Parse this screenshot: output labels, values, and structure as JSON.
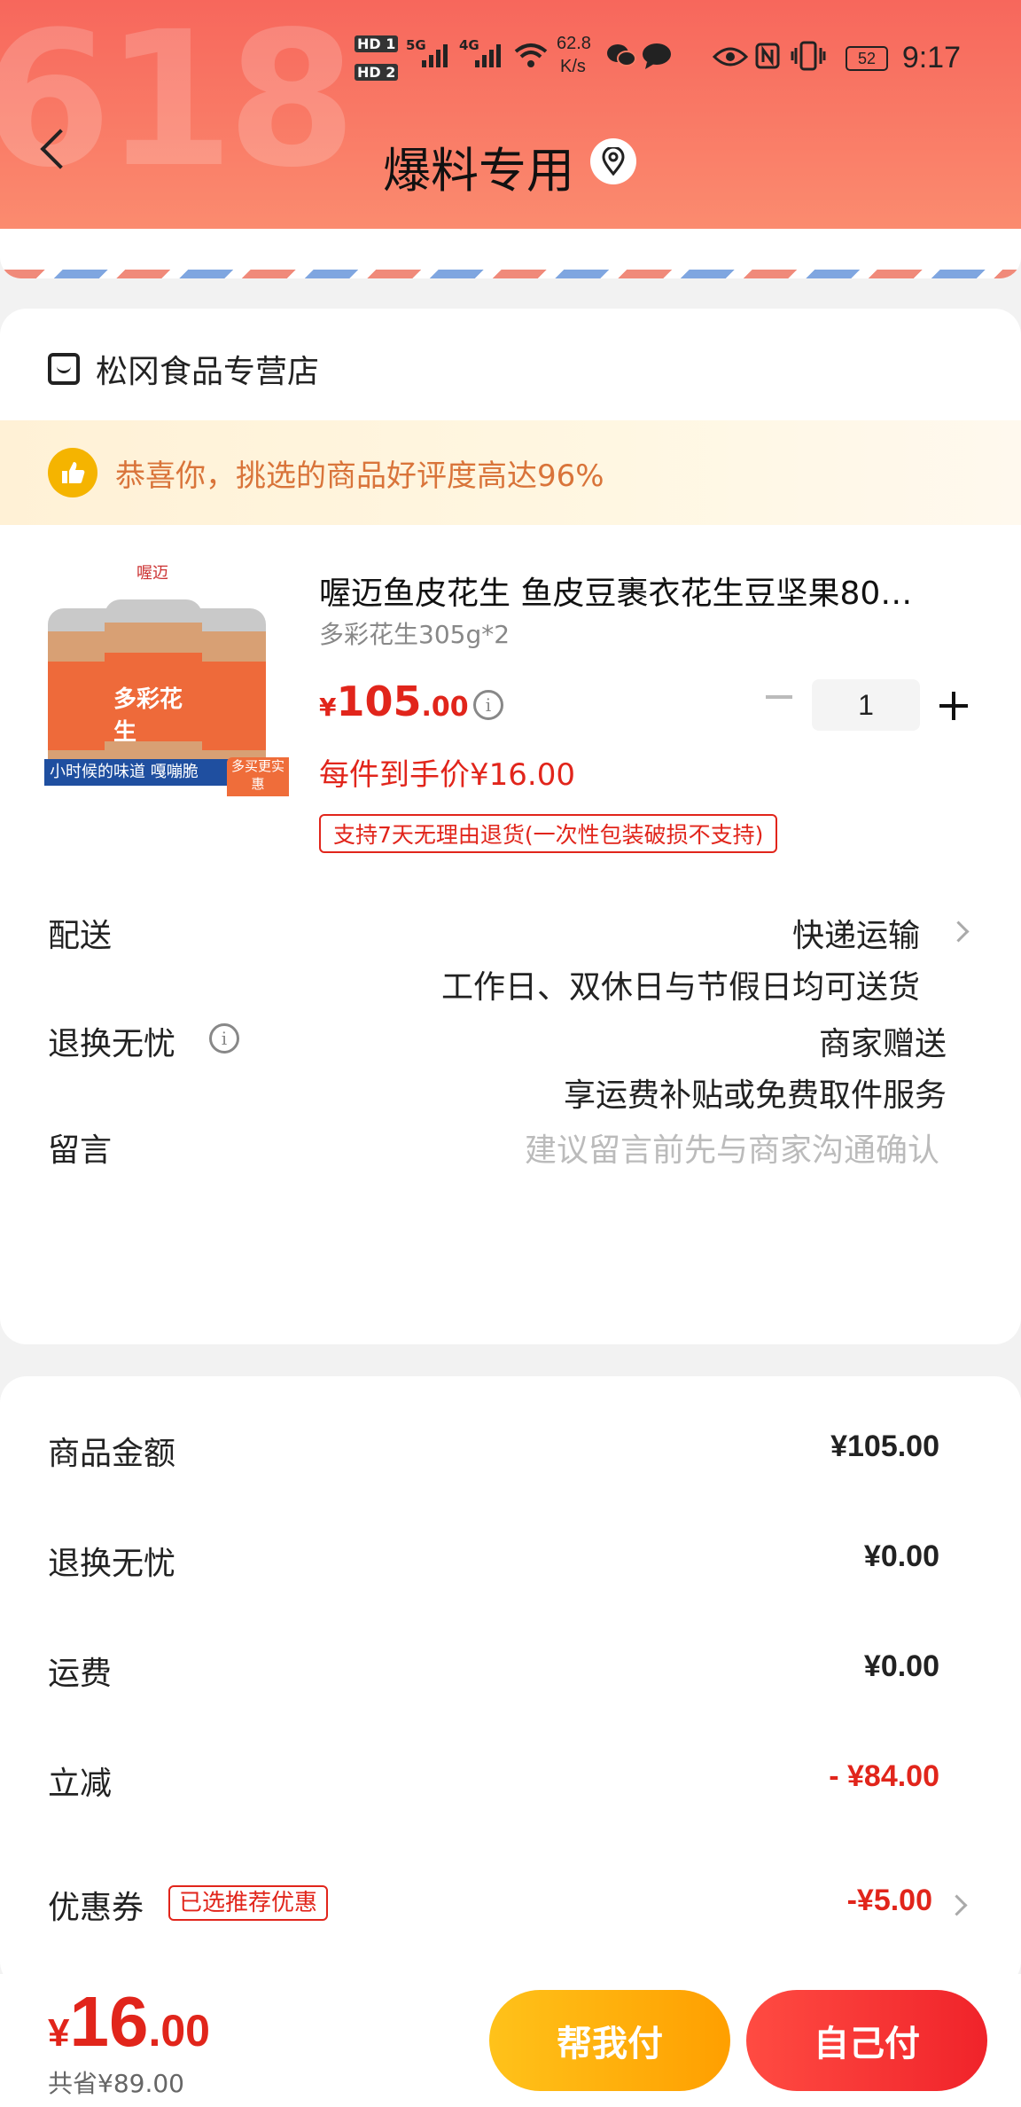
{
  "status_bar": {
    "hd1": "HD 1",
    "hd2": "HD 2",
    "net1": "5G",
    "net2": "4G",
    "speed": "62.8",
    "speed_unit": "K/s",
    "battery": "52",
    "time": "9:17"
  },
  "header": {
    "bg_text": "618",
    "title": "爆料专用"
  },
  "shop": {
    "name": "松冈食品专营店"
  },
  "praise": {
    "text": "恭喜你，挑选的商品好评度高达96%"
  },
  "product": {
    "image_brand": "喔迈",
    "image_label": "多彩花生",
    "image_banner": "小时候的味道 嘎嘣脆",
    "image_tag": "多买更实惠",
    "name": "喔迈鱼皮花生 鱼皮豆裹衣花生豆坚果80…",
    "spec": "多彩花生305g*2",
    "price_currency": "¥",
    "price_int": "105",
    "price_dec": ".00",
    "quantity": "1",
    "unit_price": "每件到手价¥16.00",
    "return_tag": "支持7天无理由退货(一次性包装破损不支持)"
  },
  "delivery": {
    "label": "配送",
    "method": "快递运输",
    "note": "工作日、双休日与节假日均可送货"
  },
  "worry_free": {
    "label": "退换无忧",
    "value": "商家赠送",
    "note": "享运费补贴或免费取件服务"
  },
  "message": {
    "label": "留言",
    "placeholder": "建议留言前先与商家沟通确认"
  },
  "summary": {
    "rows": [
      {
        "label": "商品金额",
        "value": "¥105.00"
      },
      {
        "label": "退换无忧",
        "value": "¥0.00"
      },
      {
        "label": "运费",
        "value": "¥0.00"
      },
      {
        "label": "立减",
        "value": "- ¥84.00"
      },
      {
        "label": "优惠券",
        "value": "-¥5.00"
      }
    ],
    "coupon_tag": "已选推荐优惠"
  },
  "bottom": {
    "currency": "¥",
    "total_int": "16",
    "total_dec": ".00",
    "saved": "共省¥89.00",
    "help_pay": "帮我付",
    "self_pay": "自己付"
  },
  "colors": {
    "accent_red": "#e1251b",
    "header_gradient_start": "#f7675c",
    "help_button": "#ffb000",
    "praise_text": "#d9743a"
  }
}
